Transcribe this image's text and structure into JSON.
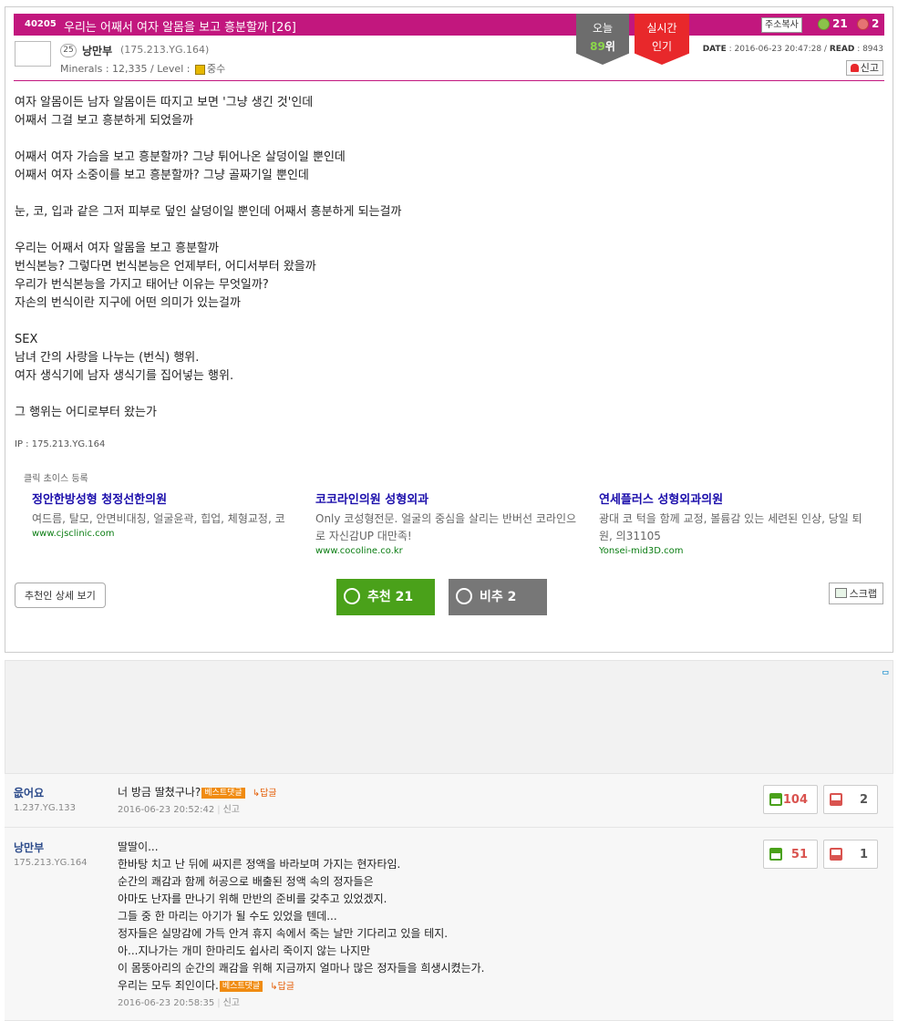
{
  "post": {
    "number": "40205",
    "title": "우리는 어째서 여자 알몸을 보고 흥분할까 [26]",
    "copy_address": "주소복사",
    "up_count": "21",
    "down_count": "2",
    "badge_today_l1": "오늘",
    "badge_today_rank": "89",
    "badge_today_suffix": "위",
    "badge_live_l1": "실시간",
    "badge_live_l2": "인기",
    "level": "25",
    "author": "낭만부",
    "author_ip": "(175.213.YG.164)",
    "minerals_prefix": "Minerals : 12,335 / Level : ",
    "level_name": "중수",
    "date_label": "DATE",
    "date_value": " : 2016-06-23 20:47:28 / ",
    "read_label": "READ",
    "read_value": " : 8943",
    "report_label": "신고",
    "body_lines": [
      "여자 알몸이든 남자 알몸이든 따지고 보면 '그냥 생긴 것'인데",
      "어째서 그걸 보고 흥분하게 되었을까",
      "",
      "어째서 여자 가슴을 보고 흥분할까? 그냥 튀어나온 살덩이일 뿐인데",
      "어째서 여자 소중이를 보고 흥분할까? 그냥 골짜기일 뿐인데",
      "",
      "눈, 코, 입과 같은 그저 피부로 덮인 살덩이일 뿐인데 어째서 흥분하게 되는걸까",
      "",
      "우리는 어째서 여자 알몸을 보고 흥분할까",
      "번식본능? 그렇다면 번식본능은 언제부터, 어디서부터 왔을까",
      "우리가 번식본능을 가지고 태어난 이유는 무엇일까?",
      "자손의 번식이란 지구에 어떤 의미가 있는걸까",
      "",
      "SEX",
      "남녀 간의 사랑을 나누는 (번식) 행위.",
      "여자 생식기에 남자 생식기를 집어넣는 행위.",
      "",
      "그 행위는 어디로부터 왔는가"
    ],
    "ip_line": "IP : 175.213.YG.164",
    "ads_header": "클릭 초이스 등록",
    "ads": [
      {
        "title": "정안한방성형 청정선한의원",
        "desc": "여드름, 탈모, 안면비대칭, 얼굴윤곽, 힙업, 체형교정, 코",
        "url": "www.cjsclinic.com"
      },
      {
        "title": "코코라인의원 성형외과",
        "desc": "Only 코성형전문. 얼굴의 중심을 살리는 반버선 코라인으로 자신감UP 대만족!",
        "url": "www.cocoline.co.kr"
      },
      {
        "title": "연세플러스 성형외과의원",
        "desc": "광대 코 턱을 함께 교정, 볼륨감 있는 세련된 인상, 당일 퇴원, 의31105",
        "url": "Yonsei-mid3D.com"
      }
    ],
    "btn_rec_detail": "추천인 상세 보기",
    "btn_up_label": "추천 21",
    "btn_down_label": "비추 2",
    "btn_scrap": "스크랩"
  },
  "ad_area": {
    "mark": "ᄆ"
  },
  "comments": [
    {
      "nick": "읎어요",
      "ip": "1.237.YG.133",
      "lines": [
        "너 방금 딸쳤구나?"
      ],
      "best": "베스트댓글",
      "reply": "↳답글",
      "date": "2016-06-23 20:52:42",
      "report": "신고",
      "up": "104",
      "down": "2"
    },
    {
      "nick": "낭만부",
      "ip": "175.213.YG.164",
      "lines": [
        "딸딸이...",
        "한바탕 치고 난 뒤에 싸지른 정액을 바라보며 가지는 현자타임.",
        "순간의 쾌감과 함께 허공으로 배출된 정액 속의 정자들은",
        "아마도 난자를 만나기 위해 만반의 준비를 갖추고 있었겠지.",
        "그들 중 한 마리는 아기가 될 수도 있었을 텐데...",
        "정자들은 실망감에 가득 안겨 휴지 속에서 죽는 날만 기다리고 있을 테지.",
        "아...지나가는 개미 한마리도 쉽사리 죽이지 않는 나지만",
        "이 몸뚱아리의 순간의 쾌감을 위해 지금까지 얼마나 많은 정자들을 희생시켰는가.",
        "우리는 모두 죄인이다."
      ],
      "best": "베스트댓글",
      "reply": "↳답글",
      "date": "2016-06-23 20:58:35",
      "report": "신고",
      "up": "51",
      "down": "1"
    }
  ]
}
